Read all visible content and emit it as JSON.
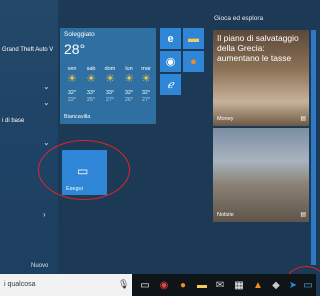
{
  "app_list": {
    "items": [
      {
        "label": "Grand Theft Auto V",
        "has_chevron": false
      },
      {
        "label": "",
        "has_chevron": true
      },
      {
        "label": "",
        "has_chevron": true
      },
      {
        "label": "i di base",
        "has_chevron": false
      },
      {
        "label": "",
        "has_chevron": true
      },
      {
        "label": "",
        "has_chevron": true
      }
    ],
    "nuovo_label": "Nuovo"
  },
  "sections": {
    "play_title": "Gioca ed esplora"
  },
  "weather": {
    "title": "Soleggiato",
    "temperature": "28°",
    "city": "Biancavilla",
    "days": [
      {
        "day": "ven",
        "high": "32°",
        "low": "22°"
      },
      {
        "day": "sab",
        "high": "33°",
        "low": "25°"
      },
      {
        "day": "dom",
        "high": "33°",
        "low": "27°"
      },
      {
        "day": "lun",
        "high": "32°",
        "low": "26°"
      },
      {
        "day": "mar",
        "high": "32°",
        "low": "27°"
      }
    ],
    "icon": "sun-icon",
    "color": "#2f6fa1"
  },
  "tiles": {
    "edge_icon": "edge-icon",
    "firefox_icon": "firefox-icon",
    "chrome_icon": "chrome-icon",
    "mail_icon": "mail-icon",
    "ie_icon": "internet-explorer-icon",
    "esegui_label": "Esegui",
    "news1_headline": "Il piano di salvataggio della Grecia: aumentano le tasse",
    "news1_source": "Money",
    "news2_source": "Notizie",
    "accent": "#2f86d6"
  },
  "taskbar": {
    "search_placeholder": "i qualcosa",
    "highlight_color": "#e0242b"
  }
}
